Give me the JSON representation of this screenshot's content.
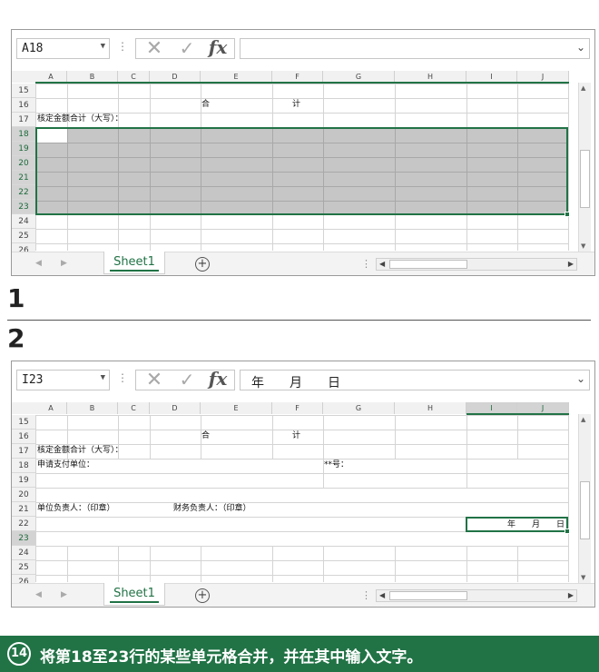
{
  "panels": [
    {
      "name_box": "A18",
      "formula": "",
      "selected_columns": [],
      "selected_rows": [
        "18",
        "19",
        "20",
        "21",
        "22",
        "23"
      ],
      "cells": [
        {
          "text": "合",
          "col": "E"
        },
        {
          "text": "计",
          "col": "F"
        },
        {
          "text": "核定金额合计（大写）：",
          "col": "A"
        }
      ]
    },
    {
      "name_box": "I23",
      "formula": "年　　月　　日",
      "selected_columns": [
        "I",
        "J"
      ],
      "selected_rows": [
        "23"
      ],
      "cells": [
        {
          "text": "合",
          "col": "E"
        },
        {
          "text": "计",
          "col": "F"
        },
        {
          "text": "核定金额合计（大写）：",
          "col": "A"
        },
        {
          "text": "申请支付单位：",
          "col": "A"
        },
        {
          "text": "**号：",
          "col": "G"
        },
        {
          "text": "单位负责人：（印章）",
          "col": "A"
        },
        {
          "text": "财务负责人：（印章）",
          "col": "D"
        },
        {
          "text": "年　　月　　日",
          "col": "I"
        }
      ]
    }
  ],
  "columns": [
    "A",
    "B",
    "C",
    "D",
    "E",
    "F",
    "G",
    "H",
    "I",
    "J"
  ],
  "rows": [
    "15",
    "16",
    "17",
    "18",
    "19",
    "20",
    "21",
    "22",
    "23",
    "24",
    "25",
    "26"
  ],
  "sheet_tab": "Sheet1",
  "add_sheet_icon": "plus-circle-icon",
  "formula_buttons": {
    "cancel": "✕",
    "enter": "✓",
    "fx": "fx"
  },
  "step_labels": [
    "1",
    "2"
  ],
  "caption": {
    "badge": "14",
    "text": "将第18至23行的某些单元格合并，并在其中输入文字。"
  },
  "colors": {
    "accent": "#217346",
    "selection_fill": "#c6c6c6"
  }
}
